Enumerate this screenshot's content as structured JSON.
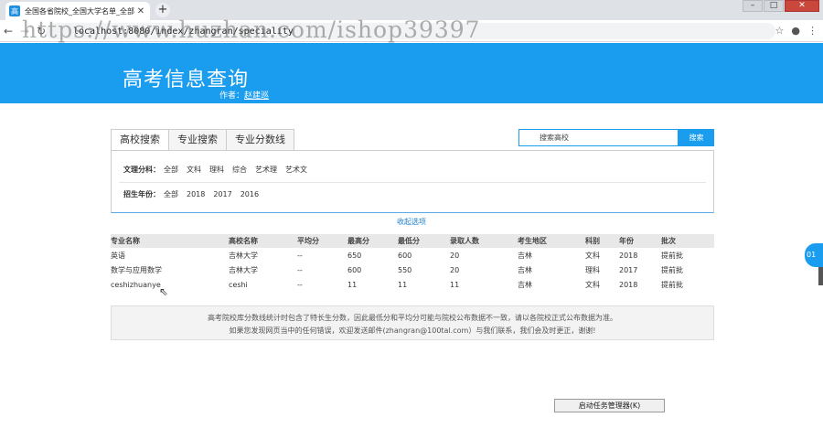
{
  "browser": {
    "tab_title": "全国各省院校_全国大学名单_全部",
    "favicon_text": "高",
    "url": "localhost:8080/index/zhangran/speciality",
    "watermark": "https://www.huzhan.com/ishop39397"
  },
  "header": {
    "title": "高考信息查询",
    "author_label": "作者：",
    "author_name": "赵建巡"
  },
  "filter": {
    "tabs": [
      "高校搜索",
      "专业搜索",
      "专业分数线"
    ],
    "search_placeholder": "搜索高校",
    "search_button": "搜索",
    "subject_label": "文理分科：",
    "subject_options": [
      "全部",
      "文科",
      "理科",
      "综合",
      "艺术理",
      "艺术文"
    ],
    "year_label": "招生年份：",
    "year_options": [
      "全部",
      "2018",
      "2017",
      "2016"
    ],
    "collapse_label": "收起选项"
  },
  "table": {
    "headers": [
      "专业名称",
      "高校名称",
      "平均分",
      "最高分",
      "最低分",
      "录取人数",
      "考生地区",
      "科别",
      "年份",
      "批次"
    ],
    "rows": [
      [
        "英语",
        "吉林大学",
        "--",
        "650",
        "600",
        "20",
        "吉林",
        "文科",
        "2018",
        "提前批"
      ],
      [
        "数学与应用数学",
        "吉林大学",
        "--",
        "600",
        "550",
        "20",
        "吉林",
        "理科",
        "2017",
        "提前批"
      ],
      [
        "ceshizhuanye",
        "ceshi",
        "--",
        "11",
        "11",
        "11",
        "吉林",
        "文科",
        "2018",
        "提前批"
      ]
    ]
  },
  "notice": {
    "line1": "高考院校库分数线统计时包含了特长生分数，因此最低分和平均分可能与院校公布数据不一致，请以各院校正式公布数据为准。",
    "line2": "如果您发现网页当中的任何错误，欢迎发送邮件(zhangran@100tal.com）与我们联系，我们会及时更正，谢谢!"
  },
  "taskbar_tip": "启动任务管理器(K)",
  "side_badge": "01"
}
